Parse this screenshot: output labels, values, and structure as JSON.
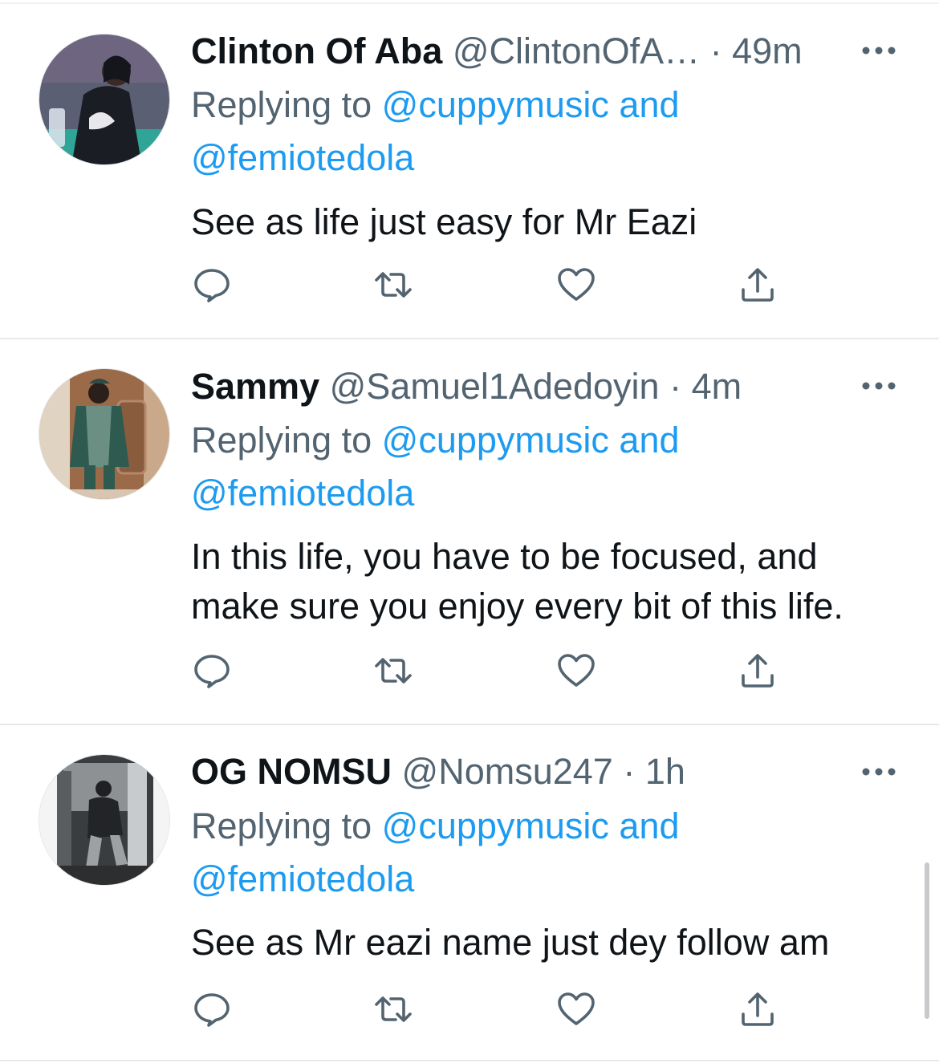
{
  "tweets": [
    {
      "name": "Clinton Of Aba",
      "handle": "@ClintonOfA…",
      "separator": "·",
      "time": "49m",
      "replying_prefix": "Replying to",
      "replying_mentions_line1": "@cuppymusic and",
      "replying_mentions_line2": "@femiotedola",
      "text_lines": [
        "See as life just easy for Mr Eazi"
      ],
      "avatar_icon": "avatar-photo-person-hoodie"
    },
    {
      "name": "Sammy",
      "handle": "@Samuel1Adedoyin",
      "separator": "·",
      "time": "4m",
      "replying_prefix": "Replying to",
      "replying_mentions_line1": "@cuppymusic and",
      "replying_mentions_line2": "@femiotedola",
      "text_lines": [
        "In this life, you have to be focused, and",
        "make sure you enjoy every bit of this life."
      ],
      "avatar_icon": "avatar-photo-person-agbada"
    },
    {
      "name": "OG NOMSU",
      "handle": "@Nomsu247",
      "separator": "·",
      "time": "1h",
      "replying_prefix": "Replying to",
      "replying_mentions_line1": "@cuppymusic and",
      "replying_mentions_line2": "@femiotedola",
      "text_lines": [
        "See as Mr eazi name just dey follow am"
      ],
      "avatar_icon": "avatar-photo-person-grayscale"
    }
  ],
  "icons": {
    "reply": "reply-icon",
    "retweet": "retweet-icon",
    "like": "like-icon",
    "share": "share-icon",
    "more": "more-options-icon"
  },
  "colors": {
    "text_primary": "#0f1419",
    "text_secondary": "#536471",
    "mention_blue": "#1d9bf0",
    "divider": "#e6e9ea"
  }
}
